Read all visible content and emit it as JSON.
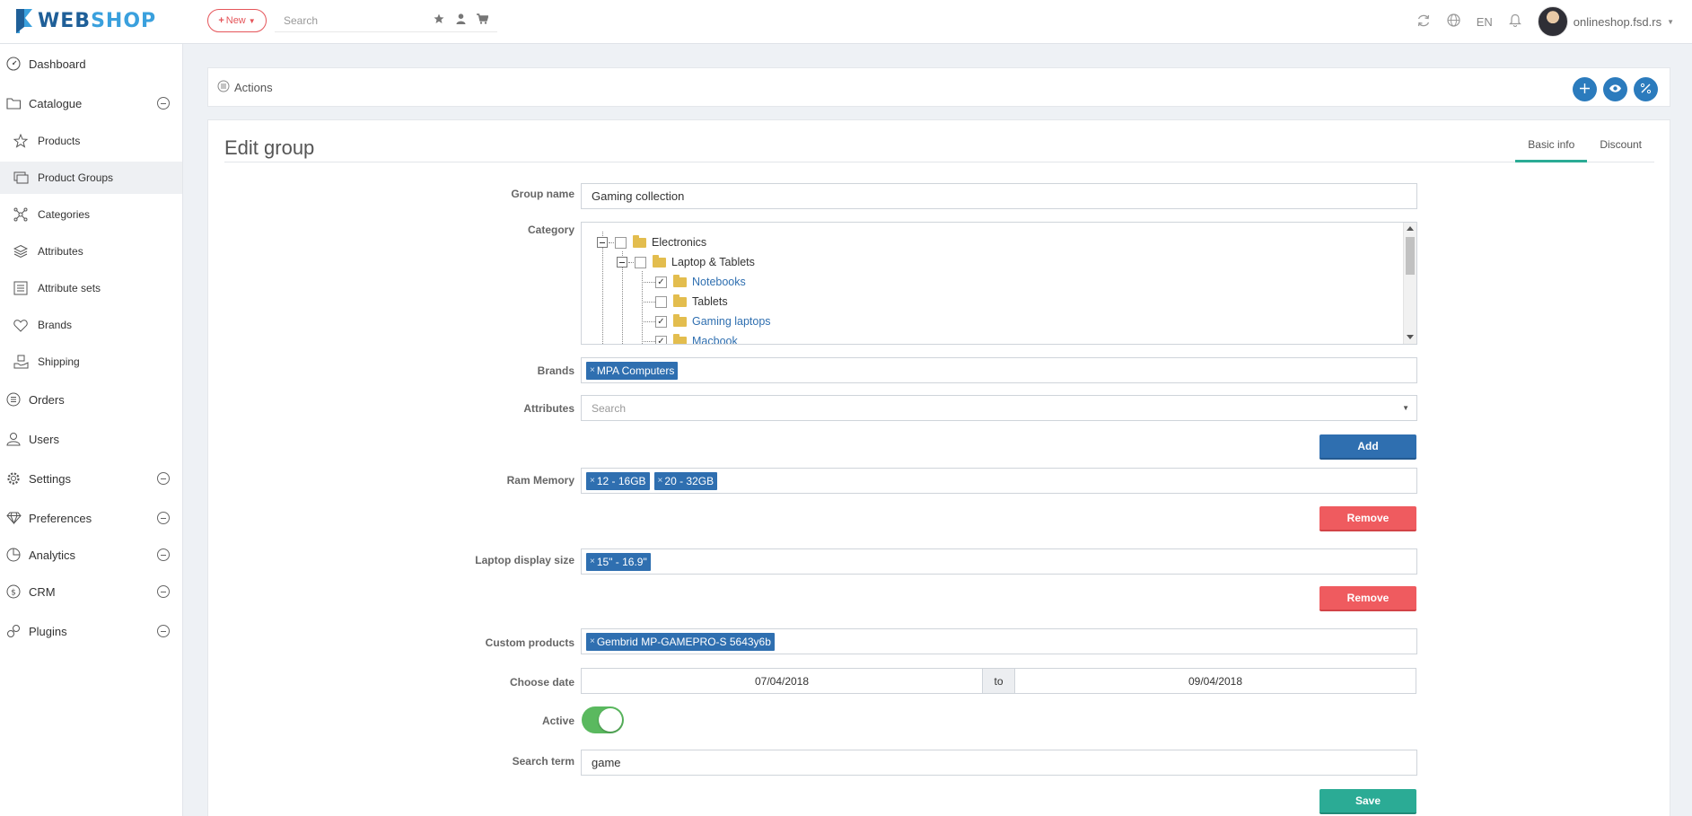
{
  "header": {
    "logo_text_1": "WEB",
    "logo_text_2": "SHOP",
    "new_label": "New",
    "search_placeholder": "Search",
    "language": "EN",
    "user_name": "onlineshop.fsd.rs"
  },
  "sidebar": {
    "items": [
      {
        "label": "Dashboard",
        "icon": "dashboard-icon"
      },
      {
        "label": "Catalogue",
        "icon": "folder-icon"
      },
      {
        "label": "Products",
        "icon": "star-icon"
      },
      {
        "label": "Product Groups",
        "icon": "groups-icon"
      },
      {
        "label": "Categories",
        "icon": "categories-icon"
      },
      {
        "label": "Attributes",
        "icon": "layers-icon"
      },
      {
        "label": "Attribute sets",
        "icon": "list-icon"
      },
      {
        "label": "Brands",
        "icon": "heart-icon"
      },
      {
        "label": "Shipping",
        "icon": "shipping-icon"
      },
      {
        "label": "Orders",
        "icon": "orders-icon"
      },
      {
        "label": "Users",
        "icon": "users-icon"
      },
      {
        "label": "Settings",
        "icon": "gear-icon"
      },
      {
        "label": "Preferences",
        "icon": "diamond-icon"
      },
      {
        "label": "Analytics",
        "icon": "pie-chart-icon"
      },
      {
        "label": "CRM",
        "icon": "dollar-icon"
      },
      {
        "label": "Plugins",
        "icon": "plug-icon"
      }
    ]
  },
  "actions": {
    "label": "Actions"
  },
  "panel": {
    "title": "Edit group",
    "tabs": [
      "Basic info",
      "Discount"
    ]
  },
  "form": {
    "group_name_label": "Group name",
    "group_name_value": "Gaming collection",
    "category_label": "Category",
    "category_tree": [
      {
        "label": "Electronics",
        "checked": false,
        "expandable": true
      },
      {
        "label": "Laptop & Tablets",
        "checked": false,
        "expandable": true
      },
      {
        "label": "Notebooks",
        "checked": true
      },
      {
        "label": "Tablets",
        "checked": false
      },
      {
        "label": "Gaming laptops",
        "checked": true
      },
      {
        "label": "Macbook",
        "checked": true
      }
    ],
    "brands_label": "Brands",
    "brands_tags": [
      "MPA Computers"
    ],
    "attributes_label": "Attributes",
    "attributes_placeholder": "Search",
    "add_label": "Add",
    "ram_label": "Ram Memory",
    "ram_tags": [
      "12 - 16GB",
      "20 - 32GB"
    ],
    "remove_label": "Remove",
    "display_label": "Laptop display size",
    "display_tags": [
      "15\" - 16.9\""
    ],
    "custom_products_label": "Custom products",
    "custom_products_tags": [
      "Gembrid MP-GAMEPRO-S 5643y6b"
    ],
    "date_label": "Choose date",
    "date_from": "07/04/2018",
    "date_to_sep": "to",
    "date_to": "09/04/2018",
    "active_label": "Active",
    "active": true,
    "search_term_label": "Search term",
    "search_term_value": "game",
    "save_label": "Save"
  },
  "colors": {
    "primary": "#2f6fb0",
    "danger": "#ef5b5f",
    "success": "#2bab95",
    "toggle_on": "#5ab95f"
  }
}
